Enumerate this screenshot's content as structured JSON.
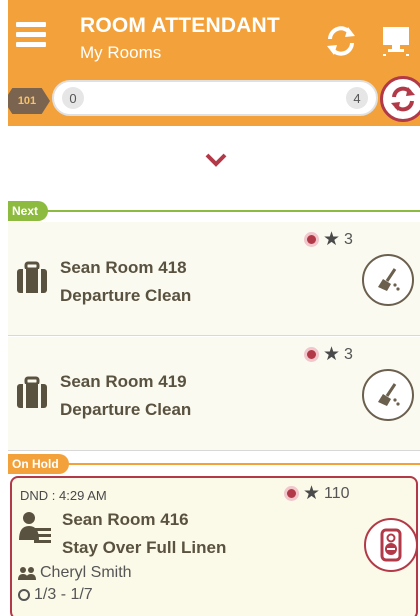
{
  "header": {
    "title": "ROOM ATTENDANT",
    "subtitle": "My Rooms",
    "icons": [
      "menu-icon",
      "sync-icon",
      "board-icon"
    ]
  },
  "progress": {
    "room_count": "101",
    "start": "0",
    "end": "4",
    "fraction": 0
  },
  "sections": {
    "next_label": "Next",
    "on_hold_label": "On Hold"
  },
  "rooms": [
    {
      "name": "Sean Room 418",
      "clean_type": "Departure Clean",
      "priority": "3",
      "icon": "luggage-icon",
      "action_icon": "broom-icon"
    },
    {
      "name": "Sean Room 419",
      "clean_type": "Departure Clean",
      "priority": "3",
      "icon": "luggage-icon",
      "action_icon": "broom-icon"
    }
  ],
  "on_hold": {
    "dnd": "DND : 4:29 AM",
    "name": "Sean Room 416",
    "clean_type": "Stay Over Full Linen",
    "priority": "110",
    "attendant": "Cheryl Smith",
    "dates": "1/3 - 1/7",
    "icon": "guest-stayover-icon",
    "action_icon": "do-not-disturb-icon"
  },
  "colors": {
    "header": "#f3a23b",
    "accent": "#b23a48",
    "next": "#8dbb3f",
    "on_hold": "#f3a23b",
    "card": "#fafaf0"
  }
}
